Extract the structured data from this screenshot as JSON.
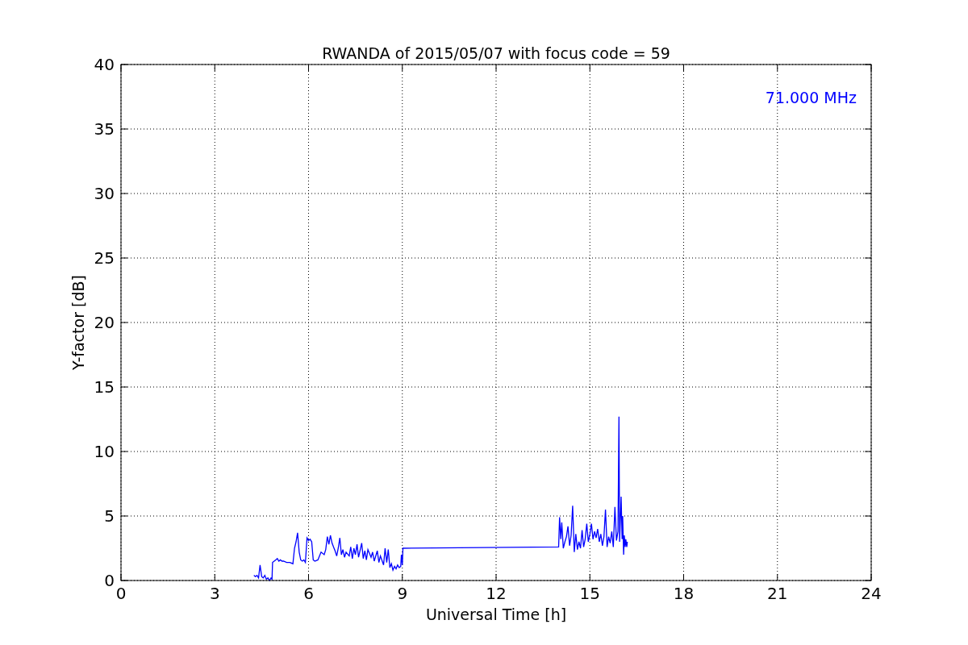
{
  "figure": {
    "chart_data": {
      "type": "line",
      "title": "RWANDA of 2015/05/07 with focus code = 59",
      "xlabel": "Universal Time [h]",
      "ylabel": "Y-factor [dB]",
      "xlim": [
        0,
        24
      ],
      "ylim": [
        0,
        40
      ],
      "xticks": [
        0,
        3,
        6,
        9,
        12,
        15,
        18,
        21,
        24
      ],
      "yticks": [
        0,
        5,
        10,
        15,
        20,
        25,
        30,
        35,
        40
      ],
      "grid": true,
      "x": [
        4.25,
        4.3,
        4.35,
        4.4,
        4.45,
        4.5,
        4.55,
        4.6,
        4.65,
        4.7,
        4.75,
        4.8,
        4.83,
        4.85,
        4.9,
        4.95,
        5.0,
        5.05,
        5.1,
        5.15,
        5.2,
        5.3,
        5.4,
        5.5,
        5.55,
        5.6,
        5.65,
        5.7,
        5.75,
        5.8,
        5.85,
        5.9,
        5.95,
        6.0,
        6.05,
        6.1,
        6.15,
        6.2,
        6.3,
        6.4,
        6.5,
        6.55,
        6.6,
        6.65,
        6.7,
        6.75,
        6.8,
        6.85,
        6.9,
        6.95,
        7.0,
        7.05,
        7.1,
        7.15,
        7.2,
        7.3,
        7.35,
        7.4,
        7.45,
        7.5,
        7.55,
        7.6,
        7.7,
        7.75,
        7.8,
        7.85,
        7.9,
        8.0,
        8.05,
        8.1,
        8.2,
        8.25,
        8.3,
        8.4,
        8.45,
        8.5,
        8.55,
        8.6,
        8.65,
        8.7,
        8.75,
        8.8,
        8.85,
        8.9,
        8.95,
        8.97,
        9.0,
        9.02,
        14.0,
        14.03,
        14.07,
        14.1,
        14.15,
        14.2,
        14.25,
        14.3,
        14.35,
        14.4,
        14.45,
        14.5,
        14.55,
        14.6,
        14.65,
        14.7,
        14.75,
        14.8,
        14.85,
        14.9,
        14.95,
        15.0,
        15.05,
        15.1,
        15.15,
        15.2,
        15.25,
        15.3,
        15.35,
        15.4,
        15.45,
        15.5,
        15.55,
        15.6,
        15.65,
        15.7,
        15.75,
        15.8,
        15.85,
        15.9,
        15.93,
        15.95,
        16.0,
        16.03,
        16.05,
        16.08,
        16.1,
        16.13,
        16.15,
        16.18,
        16.2
      ],
      "series": [
        {
          "name": "71.000 MHz",
          "color": "#0000ff",
          "values": [
            0.4,
            0.3,
            0.4,
            0.2,
            1.2,
            0.3,
            0.2,
            0.4,
            0.1,
            0.2,
            0.0,
            0.2,
            0.1,
            1.4,
            1.5,
            1.6,
            1.7,
            1.5,
            1.6,
            1.5,
            1.5,
            1.4,
            1.4,
            1.3,
            2.5,
            3.0,
            3.7,
            2.2,
            1.6,
            1.5,
            1.6,
            1.4,
            3.3,
            3.1,
            3.2,
            3.0,
            1.6,
            1.5,
            1.6,
            2.2,
            2.0,
            2.4,
            3.4,
            2.8,
            3.5,
            2.9,
            2.6,
            2.3,
            1.9,
            2.5,
            3.3,
            2.0,
            2.4,
            1.8,
            2.2,
            1.9,
            2.6,
            1.7,
            2.5,
            2.0,
            2.8,
            1.8,
            2.9,
            1.7,
            2.3,
            1.6,
            2.4,
            1.8,
            2.2,
            1.5,
            2.3,
            1.4,
            1.9,
            1.2,
            2.5,
            1.4,
            2.4,
            1.0,
            1.3,
            0.8,
            1.1,
            0.9,
            1.2,
            1.0,
            1.1,
            2.0,
            1.2,
            2.5,
            2.6,
            4.9,
            3.2,
            4.5,
            2.5,
            3.0,
            3.4,
            4.2,
            2.7,
            3.5,
            5.8,
            2.2,
            3.6,
            2.4,
            3.0,
            2.5,
            3.9,
            2.6,
            3.2,
            4.4,
            3.0,
            3.6,
            4.4,
            3.2,
            3.8,
            3.3,
            4.0,
            3.0,
            3.6,
            2.7,
            3.4,
            5.5,
            2.6,
            3.4,
            2.9,
            3.8,
            2.6,
            5.7,
            3.1,
            3.8,
            12.7,
            3.0,
            6.5,
            3.2,
            5.0,
            2.0,
            3.5,
            2.6,
            3.2,
            2.6,
            3.0
          ]
        }
      ]
    }
  }
}
